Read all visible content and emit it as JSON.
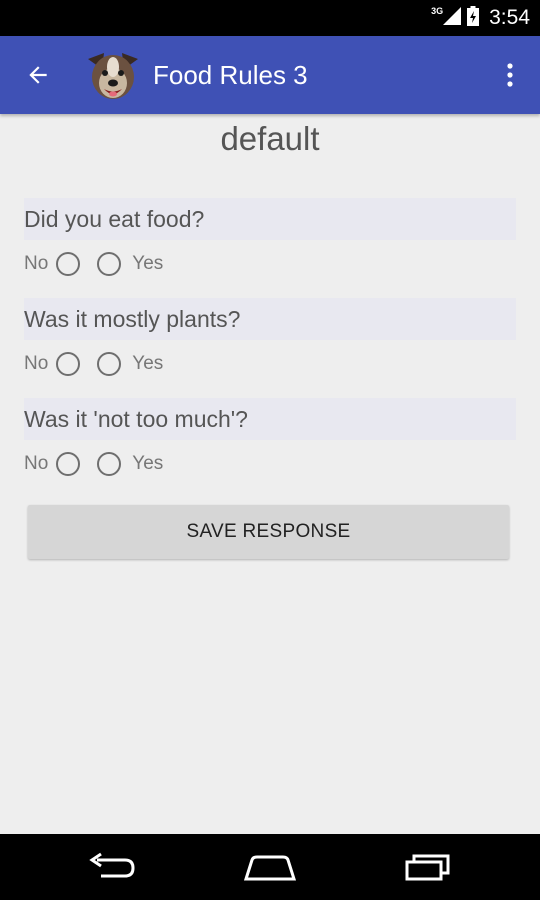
{
  "status_bar": {
    "network": "3G",
    "time": "3:54",
    "icons": [
      "signal-icon",
      "battery-icon"
    ]
  },
  "app_bar": {
    "title": "Food Rules 3",
    "color": "#3f51b5",
    "icons": {
      "back": "back-arrow-icon",
      "logo": "dog-logo-icon",
      "overflow": "overflow-menu-icon"
    }
  },
  "main": {
    "title": "default",
    "questions": [
      {
        "label": "Did you eat food?",
        "no_label": "No",
        "yes_label": "Yes"
      },
      {
        "label": "Was it mostly plants?",
        "no_label": "No",
        "yes_label": "Yes"
      },
      {
        "label": "Was it 'not too much'?",
        "no_label": "No",
        "yes_label": "Yes"
      }
    ],
    "save_label": "SAVE RESPONSE"
  },
  "nav_bar": {
    "icons": [
      "nav-back-icon",
      "home-icon",
      "recents-icon"
    ]
  }
}
